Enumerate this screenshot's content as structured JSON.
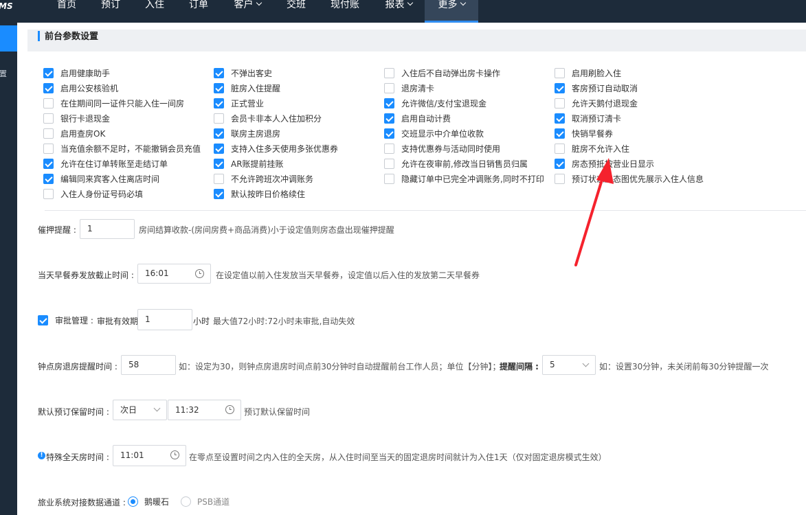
{
  "brand": "MS",
  "nav": [
    {
      "label": "首页",
      "dropdown": false,
      "active": false
    },
    {
      "label": "预订",
      "dropdown": false,
      "active": false
    },
    {
      "label": "入住",
      "dropdown": false,
      "active": false
    },
    {
      "label": "订单",
      "dropdown": false,
      "active": false
    },
    {
      "label": "客户",
      "dropdown": true,
      "active": false
    },
    {
      "label": "交班",
      "dropdown": false,
      "active": false
    },
    {
      "label": "现付账",
      "dropdown": false,
      "active": false
    },
    {
      "label": "报表",
      "dropdown": true,
      "active": false
    },
    {
      "label": "更多",
      "dropdown": true,
      "active": true
    }
  ],
  "sidebar": {
    "partial_text": "置"
  },
  "section": {
    "title": "前台参数设置"
  },
  "checkboxes": [
    [
      {
        "label": "启用健康助手",
        "checked": true
      },
      {
        "label": "启用公安核验机",
        "checked": true
      },
      {
        "label": "在住期间同一证件只能入住一间房",
        "checked": false
      },
      {
        "label": "银行卡退现金",
        "checked": false
      },
      {
        "label": "启用查房OK",
        "checked": false
      },
      {
        "label": "当充值余额不足时，不能撤销会员充值",
        "checked": false
      },
      {
        "label": "允许在住订单转账至走结订单",
        "checked": true
      },
      {
        "label": "编辑同来宾客入住离店时间",
        "checked": true
      },
      {
        "label": "入住人身份证号码必填",
        "checked": false
      }
    ],
    [
      {
        "label": "不弹出客史",
        "checked": true
      },
      {
        "label": "脏房入住提醒",
        "checked": true
      },
      {
        "label": "正式营业",
        "checked": true
      },
      {
        "label": "会员卡非本人入住加积分",
        "checked": false
      },
      {
        "label": "联房主房退房",
        "checked": true
      },
      {
        "label": "支持入住多天使用多张优惠券",
        "checked": true
      },
      {
        "label": "AR账提前挂账",
        "checked": true
      },
      {
        "label": "不允许跨班次冲调账务",
        "checked": false
      },
      {
        "label": "默认按昨日价格续住",
        "checked": true
      }
    ],
    [
      {
        "label": "入住后不自动弹出房卡操作",
        "checked": false
      },
      {
        "label": "退房清卡",
        "checked": false
      },
      {
        "label": "允许微信/支付宝退现金",
        "checked": true
      },
      {
        "label": "启用自动计费",
        "checked": true
      },
      {
        "label": "交班显示中介单位收款",
        "checked": true
      },
      {
        "label": "支持优惠券与活动同时使用",
        "checked": false
      },
      {
        "label": "允许在夜审前,修改当日销售员归属",
        "checked": false
      },
      {
        "label": "隐藏订单中已完全冲调账务,同时不打印",
        "checked": false
      }
    ],
    [
      {
        "label": "启用刷脸入住",
        "checked": false
      },
      {
        "label": "客房预订自动取消",
        "checked": true
      },
      {
        "label": "允许天鹅付退现金",
        "checked": false
      },
      {
        "label": "取消预订清卡",
        "checked": true
      },
      {
        "label": "快销早餐券",
        "checked": true
      },
      {
        "label": "脏房不允许入住",
        "checked": false
      },
      {
        "label": "房态预抵按营业日显示",
        "checked": true
      },
      {
        "label": "预订状态房态图优先展示入住人信息",
        "checked": false
      }
    ]
  ],
  "settings": {
    "deposit": {
      "label": "催押提醒 :",
      "value": "1",
      "note": "房间结算收款-(房间房费+商品消费)小于设定值则房态盘出现催押提醒"
    },
    "breakfast": {
      "label": "当天早餐券发放截止时间 :",
      "value": "16:01",
      "note": "在设定值以前入住发放当天早餐券，设定值以后入住的发放第二天早餐券"
    },
    "approval": {
      "checked": true,
      "label": "审批管理 :",
      "sub_label": "审批有效期",
      "value": "1",
      "unit": "小时",
      "note": "最大值72小时:72小时未审批,自动失效"
    },
    "hourly": {
      "label": "钟点房退房提醒时间 :",
      "value": "58",
      "note": "如：设定为30，则钟点房退房时间点前30分钟时自动提醒前台工作人员；单位【分钟】；",
      "interval_label": "提醒间隔 :",
      "interval_value": "5",
      "interval_note": "如：设置30分钟，未关闭前每30分钟提醒一次"
    },
    "hold": {
      "label": "默认预订保留时间 :",
      "day_value": "次日",
      "time_value": "11:32",
      "note": "预订默认保留时间"
    },
    "fullday": {
      "info_icon": "!",
      "label": "特殊全天房时间 :",
      "value": "11:01",
      "note": "在零点至设置时间之内入住的全天房，从入住时间至当天的固定退房时间就计为入住1天（仅对固定退房模式生效）"
    },
    "channel": {
      "label": "旅业系统对接数据通道 :",
      "options": [
        {
          "label": "鹅暖石",
          "selected": true
        },
        {
          "label": "PSB通道",
          "selected": false
        }
      ]
    }
  },
  "annotation_color": "#f5222d"
}
